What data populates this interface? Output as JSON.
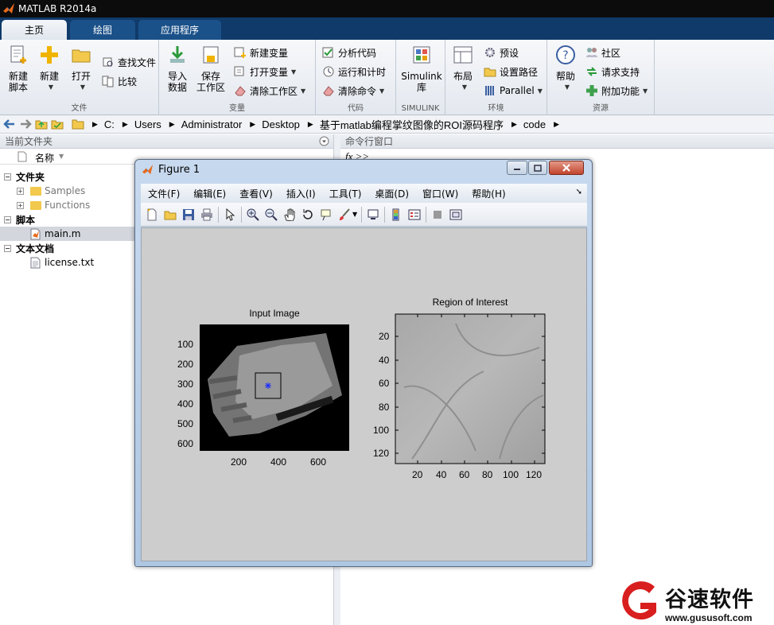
{
  "app": {
    "title": "MATLAB R2014a"
  },
  "ribbon": {
    "tabs": [
      {
        "label": "主页"
      },
      {
        "label": "绘图"
      },
      {
        "label": "应用程序"
      }
    ],
    "groups": {
      "file": {
        "label": "文件",
        "new_script": "新建\n脚本",
        "new_script_l1": "新建",
        "new_script_l2": "脚本",
        "new": "新建",
        "open": "打开",
        "find_files": "查找文件",
        "compare": "比较"
      },
      "variable": {
        "label": "变量",
        "import_l1": "导入",
        "import_l2": "数据",
        "save_l1": "保存",
        "save_l2": "工作区",
        "new_variable": "新建变量",
        "open_variable": "打开变量",
        "clear_workspace": "清除工作区"
      },
      "code": {
        "label": "代码",
        "analyze": "分析代码",
        "run_time": "运行和计时",
        "clear_commands": "清除命令"
      },
      "simulink": {
        "label": "SIMULINK",
        "btn_l1": "Simulink",
        "btn_l2": "库"
      },
      "environment": {
        "label": "环境",
        "layout": "布局",
        "preferences": "预设",
        "set_path": "设置路径",
        "parallel": "Parallel"
      },
      "resources": {
        "label": "资源",
        "help": "帮助",
        "community": "社区",
        "request_support": "请求支持",
        "addons": "附加功能"
      }
    }
  },
  "address": {
    "crumbs": [
      "C:",
      "Users",
      "Administrator",
      "Desktop",
      "基于matlab编程掌纹图像的ROI源码程序",
      "code"
    ]
  },
  "left_panel": {
    "title": "当前文件夹",
    "column_name": "名称",
    "rows": [
      {
        "label": "文件夹",
        "kind": "section"
      },
      {
        "label": "Samples",
        "kind": "folder"
      },
      {
        "label": "Functions",
        "kind": "folder"
      },
      {
        "label": "脚本",
        "kind": "section"
      },
      {
        "label": "main.m",
        "kind": "script"
      },
      {
        "label": "文本文档",
        "kind": "section"
      },
      {
        "label": "license.txt",
        "kind": "text"
      }
    ]
  },
  "command_window": {
    "title": "命令行窗口",
    "prompt": "fx >>"
  },
  "figure": {
    "title": "Figure 1",
    "menu": [
      "文件(F)",
      "编辑(E)",
      "查看(V)",
      "插入(I)",
      "工具(T)",
      "桌面(D)",
      "窗口(W)",
      "帮助(H)"
    ],
    "axes": [
      {
        "title": "Input Image",
        "yticks": [
          "100",
          "200",
          "300",
          "400",
          "500",
          "600"
        ],
        "xticks": [
          "200",
          "400",
          "600"
        ]
      },
      {
        "title": "Region of Interest",
        "yticks": [
          "20",
          "40",
          "60",
          "80",
          "100",
          "120"
        ],
        "xticks": [
          "20",
          "40",
          "60",
          "80",
          "100",
          "120"
        ]
      }
    ]
  },
  "watermark": {
    "text": "谷速软件",
    "url": "www.gususoft.com"
  }
}
